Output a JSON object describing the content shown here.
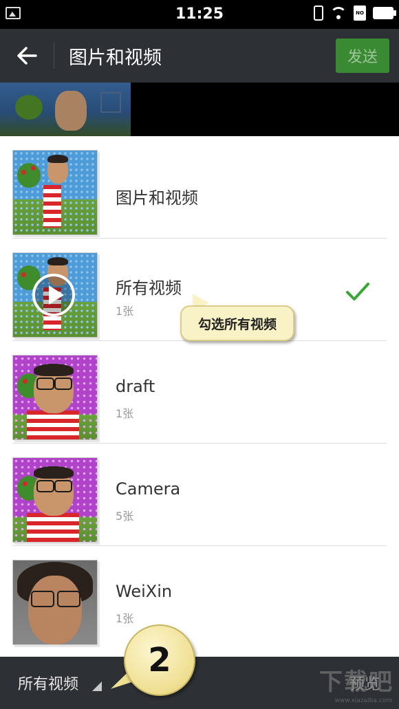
{
  "status_bar": {
    "time": "11:25",
    "sim_label": "NO"
  },
  "header": {
    "title": "图片和视频",
    "send_label": "发送"
  },
  "albums": [
    {
      "name": "图片和视频",
      "count": ""
    },
    {
      "name": "所有视频",
      "count": "1张",
      "selected": true
    },
    {
      "name": "draft",
      "count": "1张"
    },
    {
      "name": "Camera",
      "count": "5张"
    },
    {
      "name": "WeiXin",
      "count": "1张"
    }
  ],
  "tooltip": {
    "text": "勾选所有视频"
  },
  "bottom_bar": {
    "dir_label": "所有视频",
    "preview_label": "预览"
  },
  "step_badge": {
    "number": "2"
  },
  "watermark": {
    "main": "下载吧",
    "url": "www.xiazaiba.com"
  },
  "colors": {
    "accent_green": "#3a8a34",
    "check_green": "#3aa535",
    "bar_bg": "#2d3034"
  }
}
